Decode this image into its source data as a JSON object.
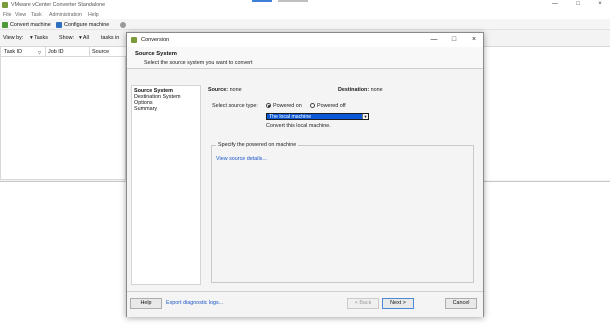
{
  "app": {
    "title": "VMware vCenter Converter Standalone",
    "menu": [
      "File",
      "View",
      "Task",
      "Administration",
      "Help"
    ],
    "toolbar": {
      "convert_label": "Convert machine",
      "configure_label": "Configure machine"
    },
    "filter": {
      "view_by_label": "View by:",
      "view_by_value": "Tasks",
      "show_label": "Show:",
      "show_value": "All",
      "tasks_in_label": "tasks in"
    },
    "grid_columns": [
      "Task ID",
      "Job ID",
      "Source"
    ],
    "window_controls": {
      "minimize": "—",
      "maximize": "□",
      "close": "×"
    }
  },
  "dialog": {
    "title": "Conversion",
    "window_controls": {
      "minimize": "—",
      "maximize": "□",
      "close": "×"
    },
    "heading": "Source System",
    "subheading": "Select the source system you want to convert",
    "nav": [
      "Source System",
      "Destination System",
      "Options",
      "Summary"
    ],
    "source_label": "Source:",
    "source_value": "none",
    "destination_label": "Destination:",
    "destination_value": "none",
    "select_type_label": "Select source type:",
    "radio_powered_on": "Powered on",
    "radio_powered_off": "Powered off",
    "selected_type": "Powered on",
    "machine_select": "The local machine",
    "machine_desc": "Convert this local machine.",
    "group_title": "Specify the powered on machine",
    "view_details_link": "View source details...",
    "help_button": "Help",
    "export_link": "Export diagnostic logs...",
    "back_button": "< Back",
    "next_button": "Next >",
    "cancel_button": "Cancel"
  },
  "colors": {
    "accent": "#0a58d6",
    "link": "#1a56c6",
    "app_icon": "#7a9c3c"
  }
}
